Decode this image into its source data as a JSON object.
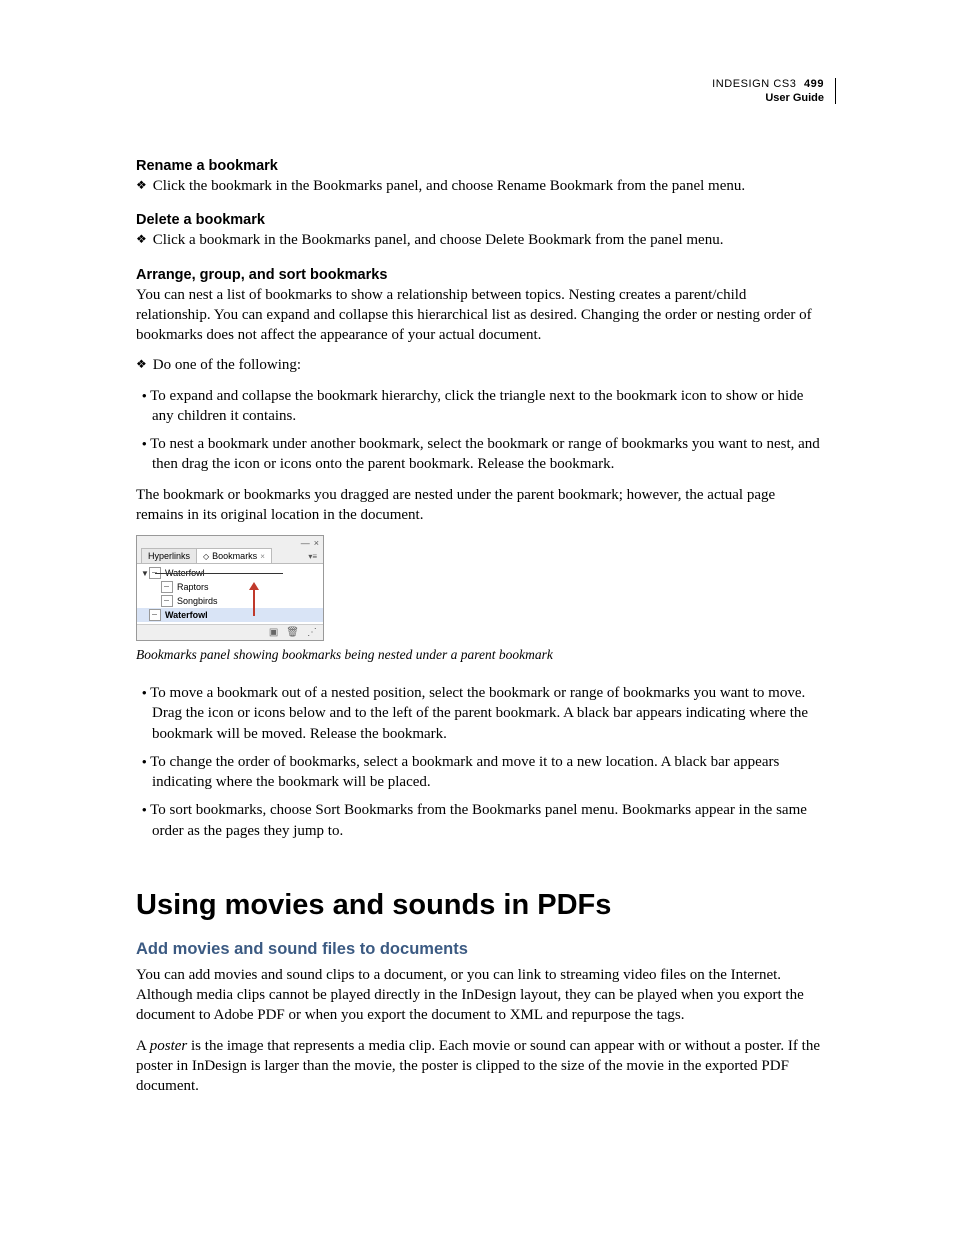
{
  "header": {
    "product": "INDESIGN CS3",
    "page_number": "499",
    "subtitle": "User Guide"
  },
  "sections": {
    "rename": {
      "title": "Rename a bookmark",
      "line": "Click the bookmark in the Bookmarks panel, and choose Rename Bookmark from the panel menu."
    },
    "delete": {
      "title": "Delete a bookmark",
      "line": "Click a bookmark in the Bookmarks panel, and choose Delete Bookmark from the panel menu."
    },
    "arrange": {
      "title": "Arrange, group, and sort bookmarks",
      "intro": "You can nest a list of bookmarks to show a relationship between topics. Nesting creates a parent/child relationship. You can expand and collapse this hierarchical list as desired. Changing the order or nesting order of bookmarks does not affect the appearance of your actual document.",
      "do_one": "Do one of the following:",
      "bullets_a": [
        "To expand and collapse the bookmark hierarchy, click the triangle next to the bookmark icon to show or hide any children it contains.",
        "To nest a bookmark under another bookmark, select the bookmark or range of bookmarks you want to nest, and then drag the icon or icons onto the parent bookmark. Release the bookmark."
      ],
      "after_a": "The bookmark or bookmarks you dragged are nested under the parent bookmark; however, the actual page remains in its original location in the document.",
      "bullets_b": [
        "To move a bookmark out of a nested position, select the bookmark or range of bookmarks you want to move. Drag the icon or icons below and to the left of the parent bookmark. A black bar appears indicating where the bookmark will be moved. Release the bookmark.",
        "To change the order of bookmarks, select a bookmark and move it to a new location. A black bar appears indicating where the bookmark will be placed.",
        "To sort bookmarks, choose Sort Bookmarks from the Bookmarks panel menu. Bookmarks appear in the same order as the pages they jump to."
      ]
    }
  },
  "figure": {
    "tab_hyperlinks": "Hyperlinks",
    "tab_bookmarks": "Bookmarks",
    "rows": {
      "r0": "Waterfowl",
      "r1": "Raptors",
      "r2": "Songbirds",
      "r3": "Waterfowl"
    },
    "caption": "Bookmarks panel showing bookmarks being nested under a parent bookmark"
  },
  "movies": {
    "title": "Using movies and sounds in PDFs",
    "sub": "Add movies and sound files to documents",
    "p1": "You can add movies and sound clips to a document, or you can link to streaming video files on the Internet. Although media clips cannot be played directly in the InDesign layout, they can be played when you export the document to Adobe PDF or when you export the document to XML and repurpose the tags.",
    "p2a": "A ",
    "p2_term": "poster",
    "p2b": " is the image that represents a media clip. Each movie or sound can appear with or without a poster. If the poster in InDesign is larger than the movie, the poster is clipped to the size of the movie in the exported PDF document."
  }
}
